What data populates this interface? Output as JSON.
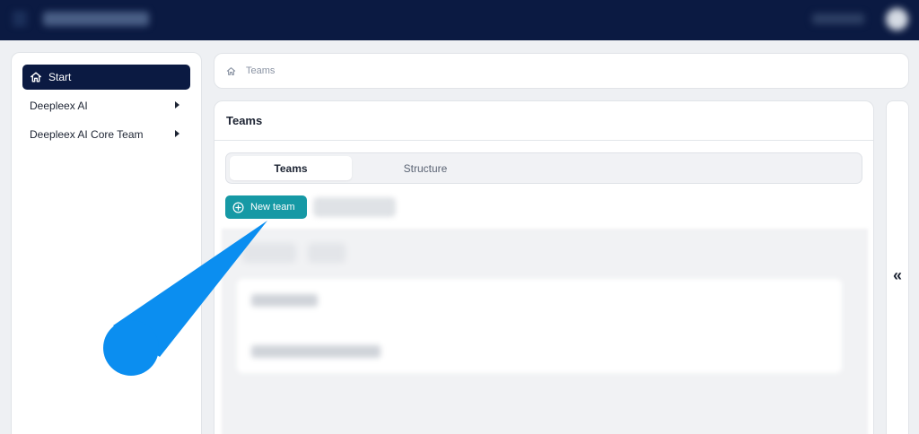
{
  "topbar": {
    "menu_icon": "menu-icon",
    "avatar_icon": "user-avatar"
  },
  "sidebar": {
    "items": [
      {
        "label": "Start",
        "icon": "home-icon",
        "active": true
      },
      {
        "label": "Deepleex AI",
        "icon": "caret-right-icon",
        "active": false
      },
      {
        "label": "Deepleex AI Core Team",
        "icon": "caret-right-icon",
        "active": false
      }
    ]
  },
  "breadcrumb": {
    "icon": "home-icon",
    "current": "Teams"
  },
  "main": {
    "title": "Teams",
    "tabs": [
      {
        "label": "Teams",
        "active": true
      },
      {
        "label": "Structure",
        "active": false
      }
    ],
    "new_team_button": {
      "label": "New team",
      "icon": "plus-circle-icon"
    }
  },
  "collapse_panel": {
    "icon": "double-chevron-left-icon",
    "glyph": "«"
  },
  "colors": {
    "topbar_bg": "#0b1a42",
    "active_nav_bg": "#0b1a42",
    "primary_button": "#1699a5",
    "pointer_annotation": "#0b8ef0"
  }
}
